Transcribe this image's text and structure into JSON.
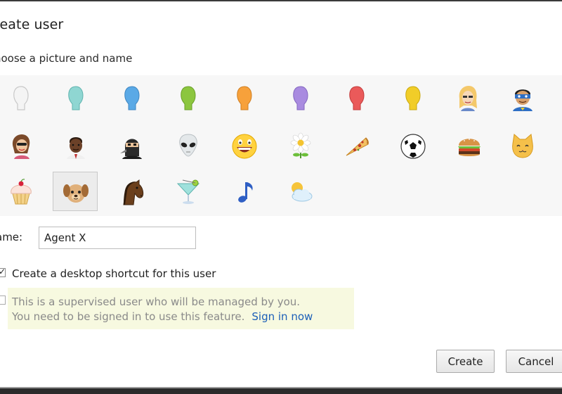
{
  "dialog": {
    "title": "reate user",
    "subtitle": "hoose a picture and name"
  },
  "avatars": [
    {
      "icon": "white-silhouette-icon",
      "color": "#f2f2f2"
    },
    {
      "icon": "teal-silhouette-icon",
      "color": "#8fd6d2"
    },
    {
      "icon": "blue-silhouette-icon",
      "color": "#5aa9e6"
    },
    {
      "icon": "green-silhouette-icon",
      "color": "#8cc63f"
    },
    {
      "icon": "orange-silhouette-icon",
      "color": "#f7a13b"
    },
    {
      "icon": "purple-silhouette-icon",
      "color": "#a98be0"
    },
    {
      "icon": "red-silhouette-icon",
      "color": "#ea5a5a"
    },
    {
      "icon": "yellow-silhouette-icon",
      "color": "#f1cd28"
    },
    {
      "icon": "blonde-woman-icon",
      "color": "#f4c86a"
    },
    {
      "icon": "superhero-icon",
      "color": "#2e6fc5"
    },
    {
      "icon": "woman-sunglasses-icon",
      "color": "#7b4a2a"
    },
    {
      "icon": "businessman-icon",
      "color": "#6b4128"
    },
    {
      "icon": "ninja-icon",
      "color": "#2a2a2a"
    },
    {
      "icon": "alien-icon",
      "color": "#d9dde0"
    },
    {
      "icon": "grinning-face-icon",
      "color": "#ffd23f"
    },
    {
      "icon": "daisy-icon",
      "color": "#ffffff"
    },
    {
      "icon": "pizza-slice-icon",
      "color": "#f3b24c"
    },
    {
      "icon": "soccer-ball-icon",
      "color": "#ffffff"
    },
    {
      "icon": "hamburger-icon",
      "color": "#c9803c"
    },
    {
      "icon": "cat-icon",
      "color": "#f5c04a"
    },
    {
      "icon": "cupcake-icon",
      "color": "#f7d6c8"
    },
    {
      "icon": "puppy-icon",
      "color": "#d6a468",
      "selected": true
    },
    {
      "icon": "horse-icon",
      "color": "#5a3519"
    },
    {
      "icon": "cocktail-glass-icon",
      "color": "#7fd2d0"
    },
    {
      "icon": "music-note-icon",
      "color": "#2f5fc4"
    },
    {
      "icon": "sun-cloud-icon",
      "color": "#f6c43a"
    }
  ],
  "name_field": {
    "label": "ame:",
    "value": "Agent X"
  },
  "desktop_shortcut": {
    "label": "Create a desktop shortcut for this user",
    "checked": true
  },
  "supervised": {
    "line1": "This is a supervised user who will be managed by you.",
    "line2": "You need to be signed in to use this feature.",
    "link": "Sign in now",
    "checked": false
  },
  "buttons": {
    "create": "Create",
    "cancel": "Cancel"
  }
}
